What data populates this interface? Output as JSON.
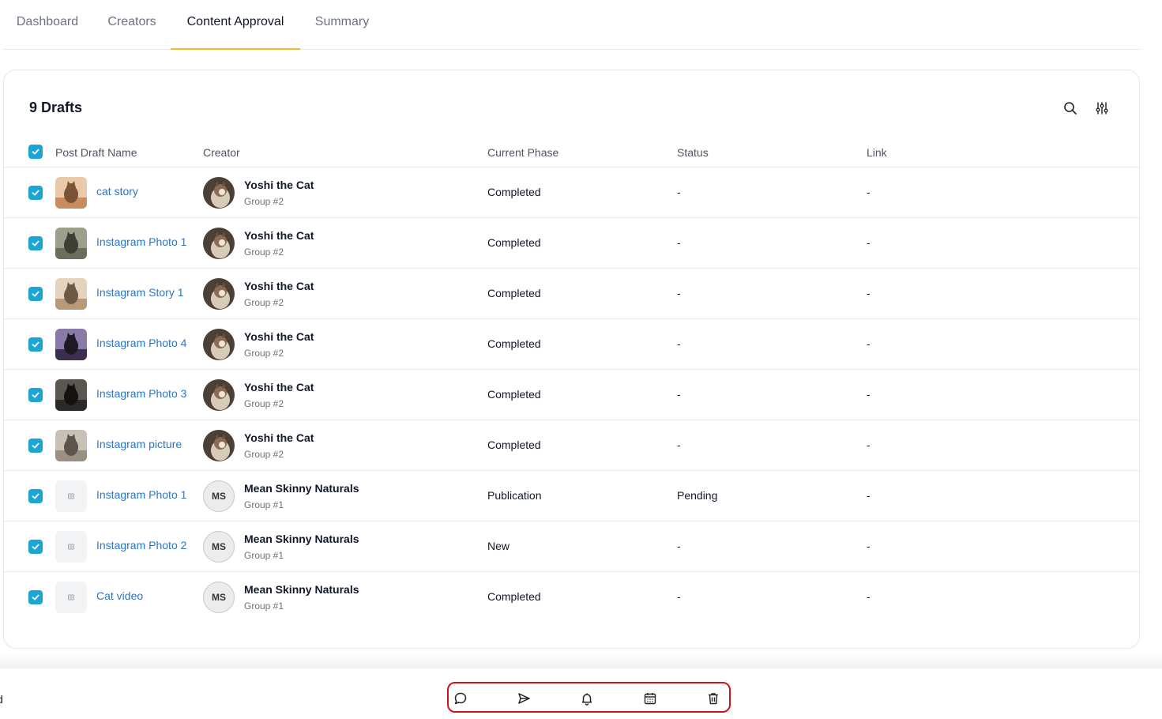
{
  "tabs": [
    {
      "label": "Dashboard",
      "active": false
    },
    {
      "label": "Creators",
      "active": false
    },
    {
      "label": "Content Approval",
      "active": true
    },
    {
      "label": "Summary",
      "active": false
    }
  ],
  "card": {
    "title": "9 Drafts",
    "icons": [
      "search-icon",
      "sliders-icon"
    ]
  },
  "columns": {
    "name": "Post Draft Name",
    "creator": "Creator",
    "phase": "Current Phase",
    "status": "Status",
    "link": "Link"
  },
  "rows": [
    {
      "checked": true,
      "thumb": "cat-photo",
      "name": "cat story",
      "creator": "Yoshi the Cat",
      "group": "Group #2",
      "avatar": "photo",
      "phase": "Completed",
      "status": "-",
      "link": "-"
    },
    {
      "checked": true,
      "thumb": "cat-photo",
      "name": "Instagram Photo 1",
      "creator": "Yoshi the Cat",
      "group": "Group #2",
      "avatar": "photo",
      "phase": "Completed",
      "status": "-",
      "link": "-"
    },
    {
      "checked": true,
      "thumb": "cat-photo",
      "name": "Instagram Story 1",
      "creator": "Yoshi the Cat",
      "group": "Group #2",
      "avatar": "photo",
      "phase": "Completed",
      "status": "-",
      "link": "-"
    },
    {
      "checked": true,
      "thumb": "cat-photo",
      "name": "Instagram Photo 4",
      "creator": "Yoshi the Cat",
      "group": "Group #2",
      "avatar": "photo",
      "phase": "Completed",
      "status": "-",
      "link": "-"
    },
    {
      "checked": true,
      "thumb": "cat-photo",
      "name": "Instagram Photo 3",
      "creator": "Yoshi the Cat",
      "group": "Group #2",
      "avatar": "photo",
      "phase": "Completed",
      "status": "-",
      "link": "-"
    },
    {
      "checked": true,
      "thumb": "cat-photo",
      "name": "Instagram picture",
      "creator": "Yoshi the Cat",
      "group": "Group #2",
      "avatar": "photo",
      "phase": "Completed",
      "status": "-",
      "link": "-"
    },
    {
      "checked": true,
      "thumb": "placeholder",
      "name": "Instagram Photo 1",
      "creator": "Mean Skinny Naturals",
      "group": "Group #1",
      "avatar": "initials",
      "initials": "MS",
      "phase": "Publication",
      "status": "Pending",
      "link": "-"
    },
    {
      "checked": true,
      "thumb": "placeholder",
      "name": "Instagram Photo 2",
      "creator": "Mean Skinny Naturals",
      "group": "Group #1",
      "avatar": "initials",
      "initials": "MS",
      "phase": "New",
      "status": "-",
      "link": "-"
    },
    {
      "checked": true,
      "thumb": "placeholder",
      "name": "Cat video",
      "creator": "Mean Skinny Naturals",
      "group": "Group #1",
      "avatar": "initials",
      "initials": "MS",
      "phase": "Completed",
      "status": "-",
      "link": "-"
    }
  ],
  "bottom_bar": {
    "selected_text": "d",
    "actions": [
      "comment-icon",
      "send-icon",
      "bell-icon",
      "calendar-icon",
      "trash-icon"
    ]
  },
  "colors": {
    "accent_tab": "#f5b92e",
    "checkbox": "#1aa5d6",
    "link": "#2f74c0",
    "action_outline": "#d0121b"
  }
}
